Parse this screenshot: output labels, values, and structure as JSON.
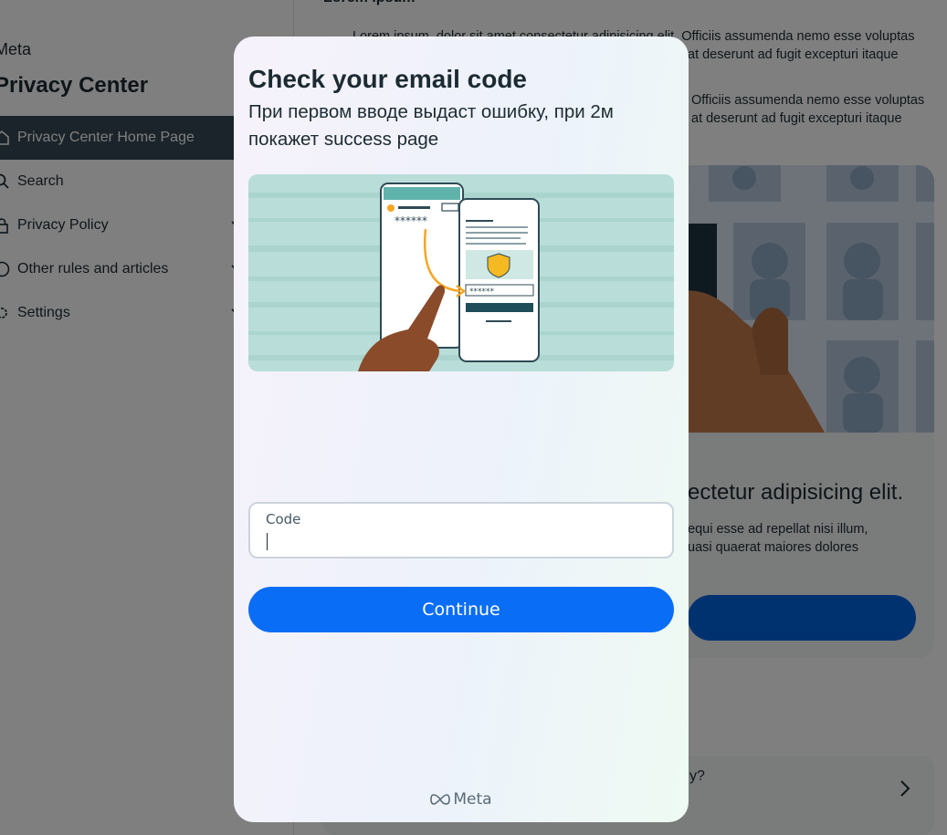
{
  "background": {
    "sidebar": {
      "brand": "Meta",
      "title": "Privacy Center",
      "items": [
        {
          "label": "Privacy Center Home Page",
          "icon": "home-icon",
          "active": true
        },
        {
          "label": "Search",
          "icon": "search-icon",
          "active": false
        },
        {
          "label": "Privacy Policy",
          "icon": "lock-icon",
          "active": false,
          "expandable": true
        },
        {
          "label": "Other rules and articles",
          "icon": "info-icon",
          "active": false,
          "expandable": true
        },
        {
          "label": "Settings",
          "icon": "gear-icon",
          "active": false,
          "expandable": true
        }
      ]
    },
    "main": {
      "section_title": "Lorem ipsum",
      "bullet_1_line_1": "Lorem ipsum, dolor sit amet consectetur adipisicing elit. Officiis assumenda nemo esse voluptas",
      "bullet_1_line_2": "at deserunt ad fugit excepturi itaque",
      "bullet_2_line_1": "Officiis assumenda nemo esse voluptas",
      "bullet_2_line_2": "at deserunt ad fugit excepturi itaque",
      "card_heading": "ectetur adipisicing elit.",
      "card_body_line_1": "equi esse ad repellat nisi illum,",
      "card_body_line_2": "uasi quaerat maiores dolores",
      "faq_question": "y?"
    }
  },
  "modal": {
    "title": "Check your email code",
    "subtitle": "При первом вводе выдаст ошибку, при 2м покажет success page",
    "code_field": {
      "label": "Code",
      "value": ""
    },
    "continue_label": "Continue",
    "footer_brand": "Meta"
  },
  "colors": {
    "primary_button": "#0a6df5",
    "sidebar_active": "#344854",
    "text": "#1c2b33"
  }
}
